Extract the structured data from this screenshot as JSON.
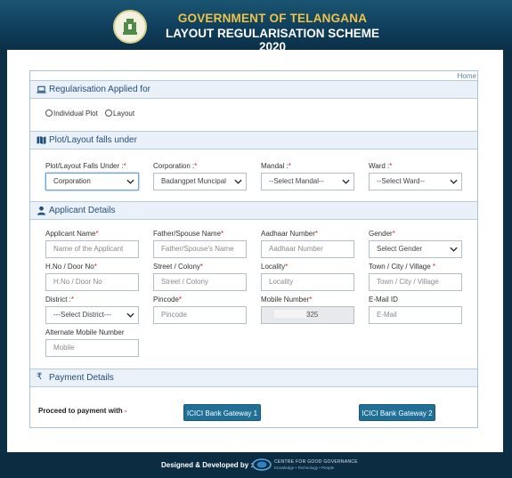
{
  "header": {
    "title_line1": "GOVERNMENT OF TELANGANA",
    "title_line2": "LAYOUT REGULARISATION SCHEME 2020"
  },
  "nav": {
    "home": "Home"
  },
  "section_regularisation": {
    "title": "Regularisation Applied for",
    "options": [
      "Individual Plot",
      "Layout"
    ]
  },
  "section_plot": {
    "title": "Plot/Layout falls under",
    "fields": [
      {
        "label": "Plot/Layout Falls Under :",
        "value": "Corporation"
      },
      {
        "label": "Corporation :",
        "value": "Badangpet Muncipal"
      },
      {
        "label": "Mandal :",
        "value": "--Select Mandal--"
      },
      {
        "label": "Ward :",
        "value": "--Select Ward--"
      }
    ]
  },
  "section_applicant": {
    "title": "Applicant Details",
    "fields": [
      {
        "label": "Applicant Name",
        "placeholder": "Name of the Applicant"
      },
      {
        "label": "Father/Spouse Name",
        "placeholder": "Father/Spouse's Name"
      },
      {
        "label": "Aadhaar Number",
        "placeholder": "Aadhaar Number"
      },
      {
        "label": "Gender",
        "value": "Select Gender"
      },
      {
        "label": "H.No / Door No",
        "placeholder": "H.No / Door No"
      },
      {
        "label": "Street / Colony",
        "placeholder": "Street / Colony"
      },
      {
        "label": "Locality",
        "placeholder": "Locality"
      },
      {
        "label": "Town / City / Village",
        "placeholder": "Town / City / Village"
      },
      {
        "label": "District :",
        "value": "---Select District---"
      },
      {
        "label": "Pincode",
        "placeholder": "Pincode"
      },
      {
        "label": "Mobile Number",
        "value": "325"
      },
      {
        "label": "E-Mail ID",
        "placeholder": "E-Mail"
      },
      {
        "label": "Alternate Mobile Number",
        "placeholder": "Mobile"
      }
    ]
  },
  "section_payment": {
    "title": "Payment Details",
    "proceed_label": "Proceed to payment with",
    "gateway1": "ICICI Bank Gateway 1",
    "gateway2": "ICICI Bank Gateway 2"
  },
  "footer": {
    "credit": "Designed & Developed by :",
    "org_name": "CENTRE FOR GOOD GOVERNANCE",
    "org_tagline": "Knowledge • Technology • People"
  },
  "colors": {
    "header_gold": "#f0c246",
    "section_text": "#23507e",
    "button": "#1f6f96",
    "required": "#d12b2b"
  }
}
